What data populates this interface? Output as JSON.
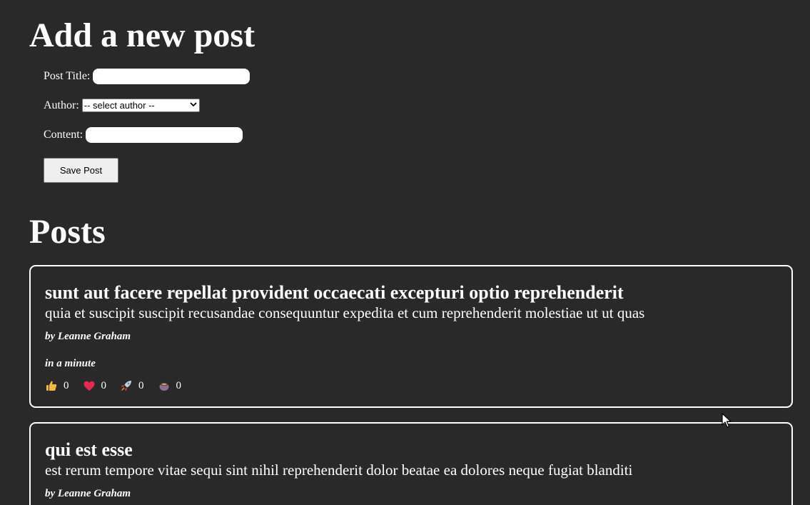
{
  "add_post": {
    "heading": "Add a new post",
    "title_label": "Post Title:",
    "title_value": "",
    "author_label": "Author:",
    "author_selected": "-- select author --",
    "content_label": "Content:",
    "content_value": "",
    "save_label": "Save Post"
  },
  "posts_section": {
    "heading": "Posts",
    "posts": [
      {
        "title": "sunt aut facere repellat provident occaecati excepturi optio reprehenderit",
        "body": "quia et suscipit suscipit recusandae consequuntur expedita et cum reprehenderit molestiae ut ut quas",
        "author": "by Leanne Graham",
        "time": "in a minute",
        "reactions": [
          {
            "icon": "thumbs-up-icon",
            "count": "0"
          },
          {
            "icon": "heart-icon",
            "count": "0"
          },
          {
            "icon": "rocket-icon",
            "count": "0"
          },
          {
            "icon": "coffee-icon",
            "count": "0"
          }
        ]
      },
      {
        "title": "qui est esse",
        "body": "est rerum tempore vitae sequi sint nihil reprehenderit dolor beatae ea dolores neque fugiat blanditi",
        "author": "by Leanne Graham"
      }
    ]
  },
  "colors": {
    "background": "#292929",
    "text": "#ffffff",
    "heart": "#e8294f",
    "thumbs": "#f5b83d"
  }
}
